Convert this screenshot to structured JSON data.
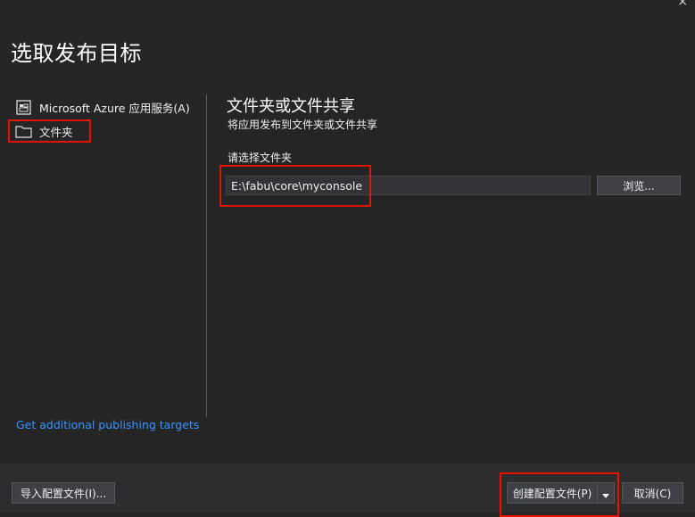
{
  "dialog": {
    "title": "选取发布目标",
    "close_glyph": "×"
  },
  "targets": [
    {
      "label": "Microsoft Azure 应用服务(A)",
      "icon": "azure-app-service-icon"
    },
    {
      "label": "文件夹",
      "icon": "folder-icon",
      "selected": true
    }
  ],
  "more_targets_link": "Get additional publishing targets",
  "folder_panel": {
    "title": "文件夹或文件共享",
    "subtitle": "将应用发布到文件夹或文件共享",
    "field_label": "请选择文件夹",
    "folder_value": "E:\\fabu\\core\\myconsole",
    "browse_label": "浏览..."
  },
  "footer": {
    "import_label": "导入配置文件(I)...",
    "create_label": "创建配置文件(P)",
    "cancel_label": "取消(C)"
  },
  "colors": {
    "background": "#252526",
    "footer": "#2d2d30",
    "link": "#3794ff",
    "highlight": "#e51400"
  }
}
